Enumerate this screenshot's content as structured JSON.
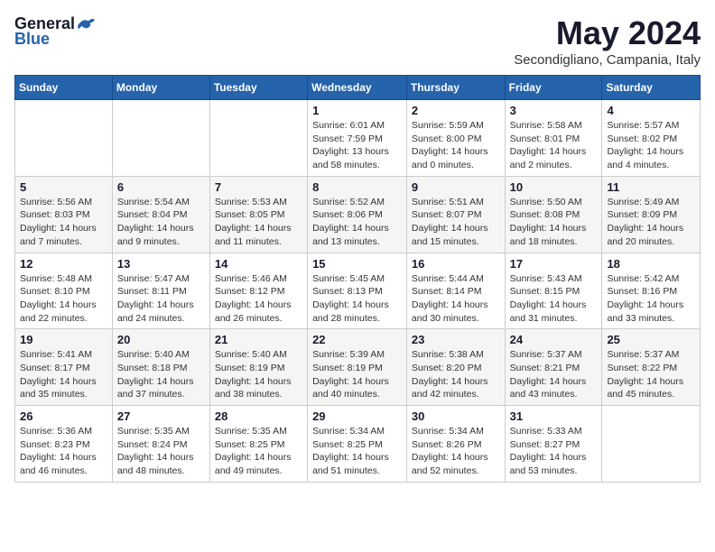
{
  "header": {
    "logo_general": "General",
    "logo_blue": "Blue",
    "month": "May 2024",
    "location": "Secondigliano, Campania, Italy"
  },
  "weekdays": [
    "Sunday",
    "Monday",
    "Tuesday",
    "Wednesday",
    "Thursday",
    "Friday",
    "Saturday"
  ],
  "weeks": [
    [
      {
        "day": "",
        "info": ""
      },
      {
        "day": "",
        "info": ""
      },
      {
        "day": "",
        "info": ""
      },
      {
        "day": "1",
        "info": "Sunrise: 6:01 AM\nSunset: 7:59 PM\nDaylight: 13 hours\nand 58 minutes."
      },
      {
        "day": "2",
        "info": "Sunrise: 5:59 AM\nSunset: 8:00 PM\nDaylight: 14 hours\nand 0 minutes."
      },
      {
        "day": "3",
        "info": "Sunrise: 5:58 AM\nSunset: 8:01 PM\nDaylight: 14 hours\nand 2 minutes."
      },
      {
        "day": "4",
        "info": "Sunrise: 5:57 AM\nSunset: 8:02 PM\nDaylight: 14 hours\nand 4 minutes."
      }
    ],
    [
      {
        "day": "5",
        "info": "Sunrise: 5:56 AM\nSunset: 8:03 PM\nDaylight: 14 hours\nand 7 minutes."
      },
      {
        "day": "6",
        "info": "Sunrise: 5:54 AM\nSunset: 8:04 PM\nDaylight: 14 hours\nand 9 minutes."
      },
      {
        "day": "7",
        "info": "Sunrise: 5:53 AM\nSunset: 8:05 PM\nDaylight: 14 hours\nand 11 minutes."
      },
      {
        "day": "8",
        "info": "Sunrise: 5:52 AM\nSunset: 8:06 PM\nDaylight: 14 hours\nand 13 minutes."
      },
      {
        "day": "9",
        "info": "Sunrise: 5:51 AM\nSunset: 8:07 PM\nDaylight: 14 hours\nand 15 minutes."
      },
      {
        "day": "10",
        "info": "Sunrise: 5:50 AM\nSunset: 8:08 PM\nDaylight: 14 hours\nand 18 minutes."
      },
      {
        "day": "11",
        "info": "Sunrise: 5:49 AM\nSunset: 8:09 PM\nDaylight: 14 hours\nand 20 minutes."
      }
    ],
    [
      {
        "day": "12",
        "info": "Sunrise: 5:48 AM\nSunset: 8:10 PM\nDaylight: 14 hours\nand 22 minutes."
      },
      {
        "day": "13",
        "info": "Sunrise: 5:47 AM\nSunset: 8:11 PM\nDaylight: 14 hours\nand 24 minutes."
      },
      {
        "day": "14",
        "info": "Sunrise: 5:46 AM\nSunset: 8:12 PM\nDaylight: 14 hours\nand 26 minutes."
      },
      {
        "day": "15",
        "info": "Sunrise: 5:45 AM\nSunset: 8:13 PM\nDaylight: 14 hours\nand 28 minutes."
      },
      {
        "day": "16",
        "info": "Sunrise: 5:44 AM\nSunset: 8:14 PM\nDaylight: 14 hours\nand 30 minutes."
      },
      {
        "day": "17",
        "info": "Sunrise: 5:43 AM\nSunset: 8:15 PM\nDaylight: 14 hours\nand 31 minutes."
      },
      {
        "day": "18",
        "info": "Sunrise: 5:42 AM\nSunset: 8:16 PM\nDaylight: 14 hours\nand 33 minutes."
      }
    ],
    [
      {
        "day": "19",
        "info": "Sunrise: 5:41 AM\nSunset: 8:17 PM\nDaylight: 14 hours\nand 35 minutes."
      },
      {
        "day": "20",
        "info": "Sunrise: 5:40 AM\nSunset: 8:18 PM\nDaylight: 14 hours\nand 37 minutes."
      },
      {
        "day": "21",
        "info": "Sunrise: 5:40 AM\nSunset: 8:19 PM\nDaylight: 14 hours\nand 38 minutes."
      },
      {
        "day": "22",
        "info": "Sunrise: 5:39 AM\nSunset: 8:19 PM\nDaylight: 14 hours\nand 40 minutes."
      },
      {
        "day": "23",
        "info": "Sunrise: 5:38 AM\nSunset: 8:20 PM\nDaylight: 14 hours\nand 42 minutes."
      },
      {
        "day": "24",
        "info": "Sunrise: 5:37 AM\nSunset: 8:21 PM\nDaylight: 14 hours\nand 43 minutes."
      },
      {
        "day": "25",
        "info": "Sunrise: 5:37 AM\nSunset: 8:22 PM\nDaylight: 14 hours\nand 45 minutes."
      }
    ],
    [
      {
        "day": "26",
        "info": "Sunrise: 5:36 AM\nSunset: 8:23 PM\nDaylight: 14 hours\nand 46 minutes."
      },
      {
        "day": "27",
        "info": "Sunrise: 5:35 AM\nSunset: 8:24 PM\nDaylight: 14 hours\nand 48 minutes."
      },
      {
        "day": "28",
        "info": "Sunrise: 5:35 AM\nSunset: 8:25 PM\nDaylight: 14 hours\nand 49 minutes."
      },
      {
        "day": "29",
        "info": "Sunrise: 5:34 AM\nSunset: 8:25 PM\nDaylight: 14 hours\nand 51 minutes."
      },
      {
        "day": "30",
        "info": "Sunrise: 5:34 AM\nSunset: 8:26 PM\nDaylight: 14 hours\nand 52 minutes."
      },
      {
        "day": "31",
        "info": "Sunrise: 5:33 AM\nSunset: 8:27 PM\nDaylight: 14 hours\nand 53 minutes."
      },
      {
        "day": "",
        "info": ""
      }
    ]
  ]
}
